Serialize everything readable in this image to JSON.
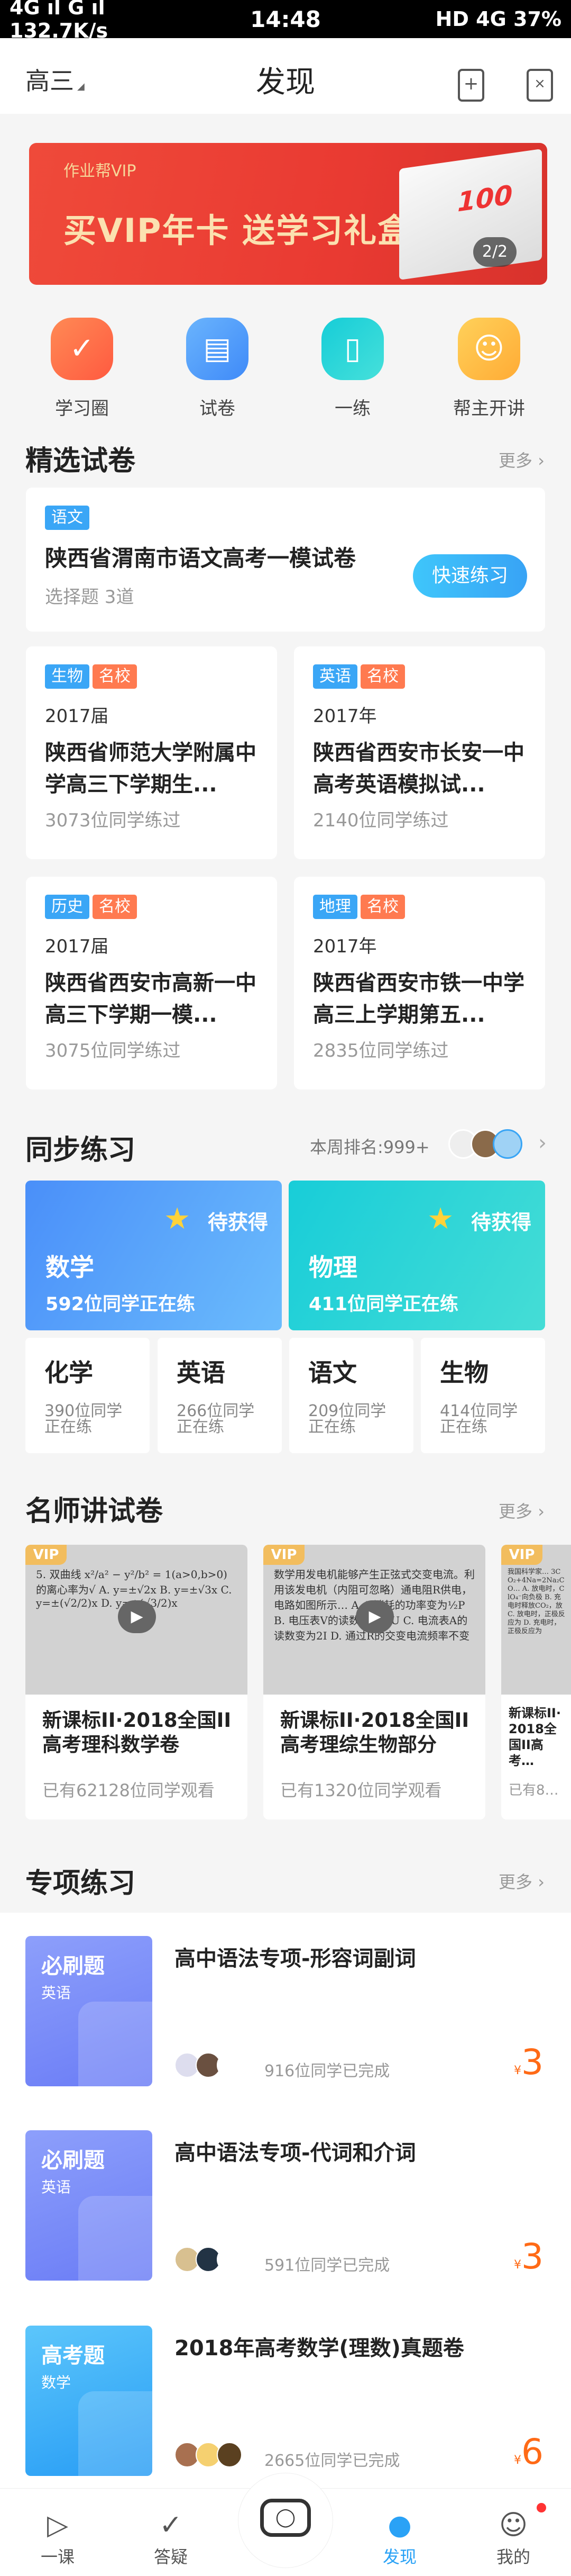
{
  "status_bar": {
    "left": "4G ıl G ıl 132.7K/s",
    "time": "14:48",
    "right": "HD 4G 37%"
  },
  "header": {
    "grade": "高三",
    "title": "发现",
    "icons": [
      "bookmark-add-icon",
      "scan-icon"
    ]
  },
  "banner": {
    "brand": "作业帮VIP",
    "slogan": "买VIP年卡 送学习礼盒",
    "gift_text": "100",
    "pager": "2/2"
  },
  "quick": [
    {
      "label": "学习圈",
      "icon": "check-circle-icon",
      "color": "#ff6f48"
    },
    {
      "label": "试卷",
      "icon": "scroll-icon",
      "color": "#4d9bfb"
    },
    {
      "label": "一练",
      "icon": "book-icon",
      "color": "#25d2d6"
    },
    {
      "label": "帮主开讲",
      "icon": "mascot-icon",
      "color": "#ffbb3a"
    }
  ],
  "featured": {
    "title": "精选试卷",
    "more": "更多",
    "top": {
      "tag": "语文",
      "name": "陕西省渭南市语文高考一模试卷",
      "meta": "选择题 3道",
      "button": "快速练习"
    },
    "papers": [
      {
        "tag": "生物",
        "badge": "名校",
        "year": "2017届",
        "name": "陕西省师范大学附属中学高三下学期生...",
        "count": "3073位同学练过"
      },
      {
        "tag": "英语",
        "badge": "名校",
        "year": "2017年",
        "name": "陕西省西安市长安一中高考英语模拟试...",
        "count": "2140位同学练过"
      },
      {
        "tag": "历史",
        "badge": "名校",
        "year": "2017届",
        "name": "陕西省西安市高新一中高三下学期一模...",
        "count": "3075位同学练过"
      },
      {
        "tag": "地理",
        "badge": "名校",
        "year": "2017年",
        "name": "陕西省西安市铁一中学高三上学期第五...",
        "count": "2835位同学练过"
      }
    ]
  },
  "sync": {
    "title": "同步练习",
    "rank": "本周排名:999+",
    "big": [
      {
        "subject": "数学",
        "status": "待获得",
        "count": "592位同学正在练"
      },
      {
        "subject": "物理",
        "status": "待获得",
        "count": "411位同学正在练"
      }
    ],
    "small": [
      {
        "subject": "化学",
        "count": "390位同学正在练"
      },
      {
        "subject": "英语",
        "count": "266位同学正在练"
      },
      {
        "subject": "语文",
        "count": "209位同学正在练"
      },
      {
        "subject": "生物",
        "count": "414位同学正在练"
      }
    ]
  },
  "teacher": {
    "title": "名师讲试卷",
    "more": "更多",
    "videos": [
      {
        "badge": "VIP",
        "preview": "5. 双曲线 x²/a² − y²/b² = 1(a>0,b>0)的离心率为√ A. y=±√2x B. y=±√3x C. y=±(√2/2)x D. y=±(√3/2)x",
        "title": "新课标II·2018全国II高考理科数学卷",
        "watched": "已有62128位同学观看"
      },
      {
        "badge": "VIP",
        "preview": "数学用发电机能够产生正弦式交变电流。利用该发电机（内阻可忽略）通电阻R供电，电路如图所示… A. R消耗的功率变为½P B. 电压表V的读数变为½U C. 电流表A的读数变为2I D. 通过R的交变电流频率不变",
        "title": "新课标II·2018全国II高考理综生物部分",
        "watched": "已有1320位同学观看"
      },
      {
        "badge": "VIP",
        "preview": "我国科学家… 3CO₂+4Na=2Na₂CO… A. 放电时，ClO₄⁻向负极 B. 充电时释放CO₂，放 C. 放电时，正极反应为 D. 充电时，正极反应为",
        "title": "新课标II·2018全国II高考…",
        "watched": "已有8…"
      }
    ]
  },
  "special": {
    "title": "专项练习",
    "more": "更多",
    "items": [
      {
        "kind": "必刷题",
        "subject": "英语",
        "title": "高中语法专项-形容词副词",
        "done": "916位同学已完成",
        "currency": "¥",
        "price": "3"
      },
      {
        "kind": "必刷题",
        "subject": "英语",
        "title": "高中语法专项-代词和介词",
        "done": "591位同学已完成",
        "currency": "¥",
        "price": "3"
      },
      {
        "kind": "高考题",
        "subject": "数学",
        "title": "2018年高考数学(理数)真题卷",
        "done": "2665位同学已完成",
        "currency": "¥",
        "price": "6"
      }
    ]
  },
  "tabs": [
    {
      "label": "一课",
      "icon": "video-camera-icon"
    },
    {
      "label": "答疑",
      "icon": "chat-check-icon"
    },
    {
      "label": "",
      "icon": "camera-icon"
    },
    {
      "label": "发现",
      "icon": "planet-icon",
      "active": true
    },
    {
      "label": "我的",
      "icon": "smiley-icon"
    }
  ],
  "colors": {
    "accent": "#2aa2f6",
    "tag_blue": "#3aa6f6",
    "tag_orange": "#ff7a50",
    "price": "#ff6a16"
  }
}
